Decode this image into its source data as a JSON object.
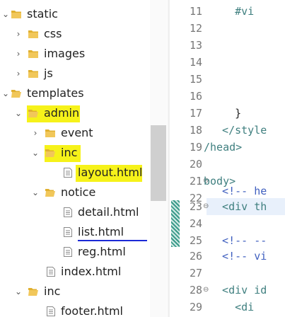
{
  "tree": {
    "items": [
      {
        "label": "static"
      },
      {
        "label": "css"
      },
      {
        "label": "images"
      },
      {
        "label": "js"
      },
      {
        "label": "templates"
      },
      {
        "label": "admin"
      },
      {
        "label": "event"
      },
      {
        "label": "inc"
      },
      {
        "label": "layout.html"
      },
      {
        "label": "notice"
      },
      {
        "label": "detail.html"
      },
      {
        "label": "list.html"
      },
      {
        "label": "reg.html"
      },
      {
        "label": "index.html"
      },
      {
        "label": "inc"
      },
      {
        "label": "footer.html"
      }
    ]
  },
  "editor": {
    "lines": [
      {
        "num": "11",
        "text": "    #vi"
      },
      {
        "num": "12",
        "text": ""
      },
      {
        "num": "13",
        "text": ""
      },
      {
        "num": "14",
        "text": ""
      },
      {
        "num": "15",
        "text": ""
      },
      {
        "num": "16",
        "text": ""
      },
      {
        "num": "17",
        "text": "    }"
      },
      {
        "num": "18",
        "text": "  </style"
      },
      {
        "num": "19",
        "text": "/head>"
      },
      {
        "num": "20",
        "text": ""
      },
      {
        "num": "21",
        "text": "body>"
      },
      {
        "num": "22",
        "text": "  <!-- he"
      },
      {
        "num": "23",
        "text": "  <div th"
      },
      {
        "num": "24",
        "text": ""
      },
      {
        "num": "25",
        "text": "  <!-- --"
      },
      {
        "num": "26",
        "text": "  <!-- vi"
      },
      {
        "num": "27",
        "text": ""
      },
      {
        "num": "28",
        "text": "  <div id"
      },
      {
        "num": "29",
        "text": "    <di"
      }
    ]
  },
  "colors": {
    "highlight": "#f6f21a",
    "underline": "#1c2ad6",
    "folder": "#e0b030"
  }
}
